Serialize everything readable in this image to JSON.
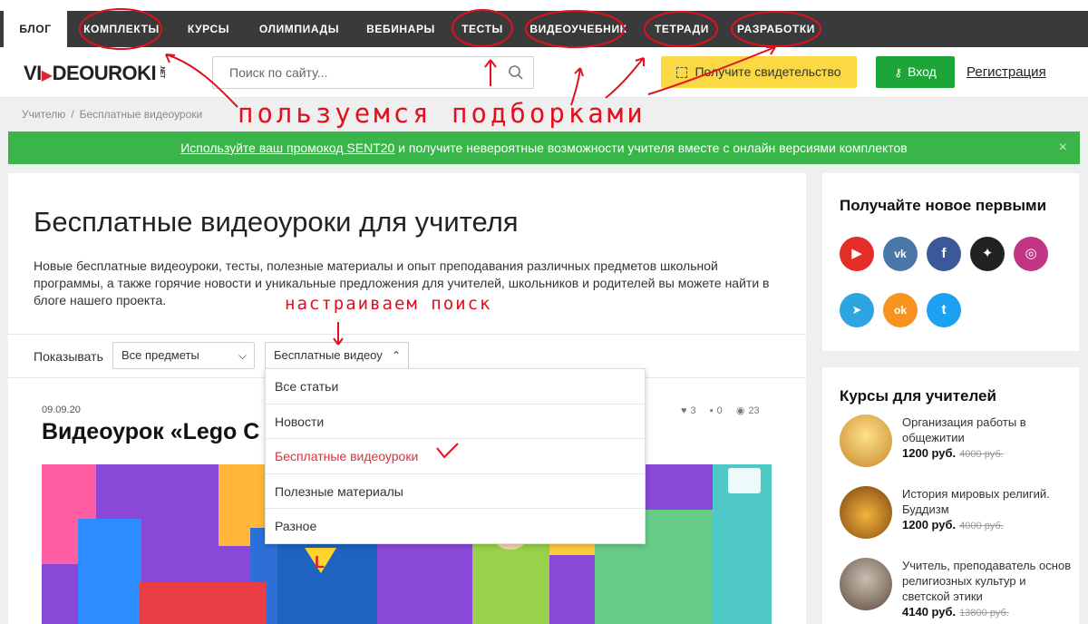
{
  "nav": {
    "items": [
      "БЛОГ",
      "КОМПЛЕКТЫ",
      "КУРСЫ",
      "ОЛИМПИАДЫ",
      "ВЕБИНАРЫ",
      "ТЕСТЫ",
      "ВИДЕОУЧЕБНИК",
      "ТЕТРАДИ",
      "РАЗРАБОТКИ"
    ],
    "active_index": 0
  },
  "header": {
    "logo_a": "VI",
    "logo_b": "DEOUROKI",
    "logo_net": ".NET",
    "search_placeholder": "Поиск по сайту...",
    "search_icon": "search-icon",
    "cert_button": "Получите свидетельство",
    "login_button": "Вход",
    "register_link": "Регистрация"
  },
  "breadcrumb": {
    "items": [
      "Учителю",
      "Бесплатные видеоуроки"
    ],
    "separator": "/"
  },
  "promo": {
    "link_text": "Используйте ваш промокод SENT20",
    "rest_text": " и получите невероятные возможности учителя вместе с онлайн версиями комплектов",
    "close": "×"
  },
  "main": {
    "title": "Бесплатные видеоуроки для учителя",
    "description": "Новые бесплатные видеоуроки, тесты, полезные материалы и опыт преподавания различных предметов школьной программы, а также горячие новости и уникальные предложения для учителей, школьников и родителей вы можете найти в блоге нашего проекта.",
    "filter_label": "Показывать",
    "subject_select": "Все предметы",
    "category_select": "Бесплатные видеоу",
    "dropdown_options": [
      "Все статьи",
      "Новости",
      "Бесплатные видеоуроки",
      "Полезные материалы",
      "Разное"
    ],
    "dropdown_selected_index": 2
  },
  "post": {
    "date": "09.09.20",
    "title": "Видеоурок «Lego C",
    "likes": "3",
    "comments": "0",
    "views": "23"
  },
  "sidebar": {
    "subscribe_title": "Получайте новое первыми",
    "socials": [
      {
        "icon": "youtube-icon",
        "color": "#e52d27",
        "glyph": "▶"
      },
      {
        "icon": "vk-icon",
        "color": "#4a76a8",
        "glyph": "vk"
      },
      {
        "icon": "facebook-icon",
        "color": "#3b5998",
        "glyph": "f"
      },
      {
        "icon": "zen-icon",
        "color": "#222222",
        "glyph": "✦"
      },
      {
        "icon": "instagram-icon",
        "color": "#c13584",
        "glyph": "◎"
      },
      {
        "icon": "telegram-icon",
        "color": "#2ca5e0",
        "glyph": "➤"
      },
      {
        "icon": "odnoklassniki-icon",
        "color": "#f7931e",
        "glyph": "ok"
      },
      {
        "icon": "twitter-icon",
        "color": "#1da1f2",
        "glyph": "t"
      }
    ],
    "courses_title": "Курсы для учителей",
    "courses": [
      {
        "title": "Организация работы в общежитии",
        "price": "1200 руб.",
        "old_price": "4000 руб."
      },
      {
        "title": "История мировых религий. Буддизм",
        "price": "1200 руб.",
        "old_price": "4000 руб."
      },
      {
        "title": "Учитель, преподаватель основ религиозных культур и светской этики",
        "price": "4140 руб.",
        "old_price": "13800 руб."
      }
    ]
  },
  "annotations": {
    "collections_note": "пользуемся подборками",
    "search_note": "настраиваем поиск"
  },
  "colors": {
    "accent_red": "#d9323c",
    "green": "#39b54a",
    "login_green": "#1ba637",
    "cert_yellow": "#fbd944",
    "nav_dark": "#3a3a3a"
  }
}
